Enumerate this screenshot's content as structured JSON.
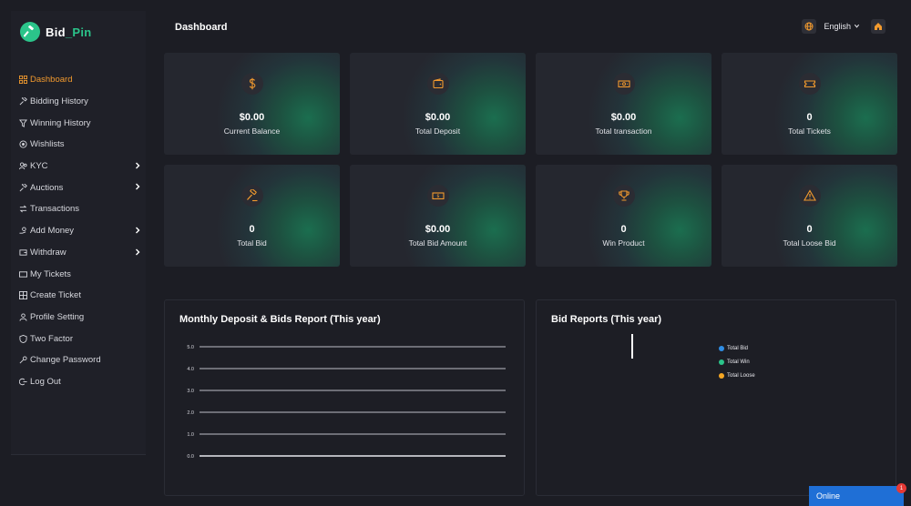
{
  "brand": {
    "name_part1": "Bid",
    "name_sep": "_",
    "name_part2": "Pin",
    "accent_color": "#2bc48a"
  },
  "colors": {
    "active_nav": "#f29a2e",
    "card_icon": "#f29a2e",
    "chat_button": "#1f6fd6"
  },
  "header": {
    "title": "Dashboard",
    "language": "English",
    "language_icon": "globe-icon",
    "home_icon": "home-icon"
  },
  "sidebar": {
    "items": [
      {
        "label": "Dashboard",
        "icon": "home-icon",
        "active": true
      },
      {
        "label": "Bidding History",
        "icon": "gavel-icon"
      },
      {
        "label": "Winning History",
        "icon": "filter-icon"
      },
      {
        "label": "Wishlists",
        "icon": "target-icon"
      },
      {
        "label": "KYC",
        "icon": "users-icon",
        "has_submenu": true
      },
      {
        "label": "Auctions",
        "icon": "gavel-icon",
        "has_submenu": true
      },
      {
        "label": "Transactions",
        "icon": "transfer-icon"
      },
      {
        "label": "Add Money",
        "icon": "hand-coin-icon",
        "has_submenu": true
      },
      {
        "label": "Withdraw",
        "icon": "wallet-icon",
        "has_submenu": true
      },
      {
        "label": "My Tickets",
        "icon": "ticket-icon"
      },
      {
        "label": "Create Ticket",
        "icon": "grid-icon"
      },
      {
        "label": "Profile Setting",
        "icon": "user-icon"
      },
      {
        "label": "Two Factor",
        "icon": "shield-icon"
      },
      {
        "label": "Change Password",
        "icon": "key-icon"
      },
      {
        "label": "Log Out",
        "icon": "logout-icon"
      }
    ]
  },
  "cards": [
    {
      "value": "$0.00",
      "label": "Current Balance",
      "icon": "dollar-icon"
    },
    {
      "value": "$0.00",
      "label": "Total Deposit",
      "icon": "wallet-icon"
    },
    {
      "value": "$0.00",
      "label": "Total transaction",
      "icon": "money-icon"
    },
    {
      "value": "0",
      "label": "Total Tickets",
      "icon": "ticket-icon"
    },
    {
      "value": "0",
      "label": "Total Bid",
      "icon": "gavel-icon"
    },
    {
      "value": "$0.00",
      "label": "Total Bid Amount",
      "icon": "cash-icon"
    },
    {
      "value": "0",
      "label": "Win Product",
      "icon": "trophy-icon"
    },
    {
      "value": "0",
      "label": "Total Loose Bid",
      "icon": "warning-icon"
    }
  ],
  "monthly_panel": {
    "title": "Monthly Deposit & Bids Report (This year)"
  },
  "bid_panel": {
    "title": "Bid Reports (This year)"
  },
  "chat": {
    "label": "Online",
    "badge": "1"
  },
  "chart_data": [
    {
      "type": "line",
      "title": "Monthly Deposit & Bids Report (This year)",
      "yticks": [
        "5.0",
        "4.0",
        "3.0",
        "2.0",
        "1.0",
        "0.0"
      ],
      "ylim": [
        0,
        5
      ],
      "grid": true,
      "series": []
    },
    {
      "type": "pie",
      "title": "Bid Reports (This year)",
      "legend_position": "right",
      "categories": [
        "Total Bid",
        "Total Win",
        "Total Loose"
      ],
      "colors": [
        "#2f8de4",
        "#2bc48a",
        "#f5a623"
      ],
      "values": [
        0,
        0,
        0
      ]
    }
  ]
}
